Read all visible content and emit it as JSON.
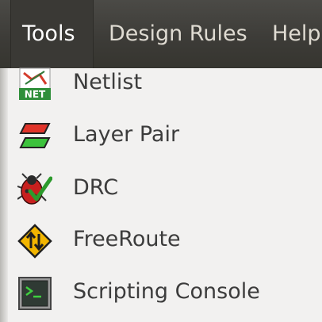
{
  "menubar": {
    "items": [
      {
        "label": "Tools",
        "active": true
      },
      {
        "label": "Design Rules",
        "active": false
      },
      {
        "label": "Help",
        "active": false
      }
    ]
  },
  "tools_menu": {
    "items": [
      {
        "label": "Netlist",
        "icon": "netlist-icon"
      },
      {
        "label": "Layer Pair",
        "icon": "layer-pair-icon"
      },
      {
        "label": "DRC",
        "icon": "drc-icon"
      },
      {
        "label": "FreeRoute",
        "icon": "freeroute-icon"
      },
      {
        "label": "Scripting Console",
        "icon": "scripting-console-icon"
      }
    ],
    "netlist_icon_text": "NET"
  },
  "colors": {
    "menubar_bg": "#3c3b37",
    "menu_bg": "#f2f1f0",
    "menu_text": "#3c3c3c",
    "menubar_text": "#dfdbd2"
  }
}
